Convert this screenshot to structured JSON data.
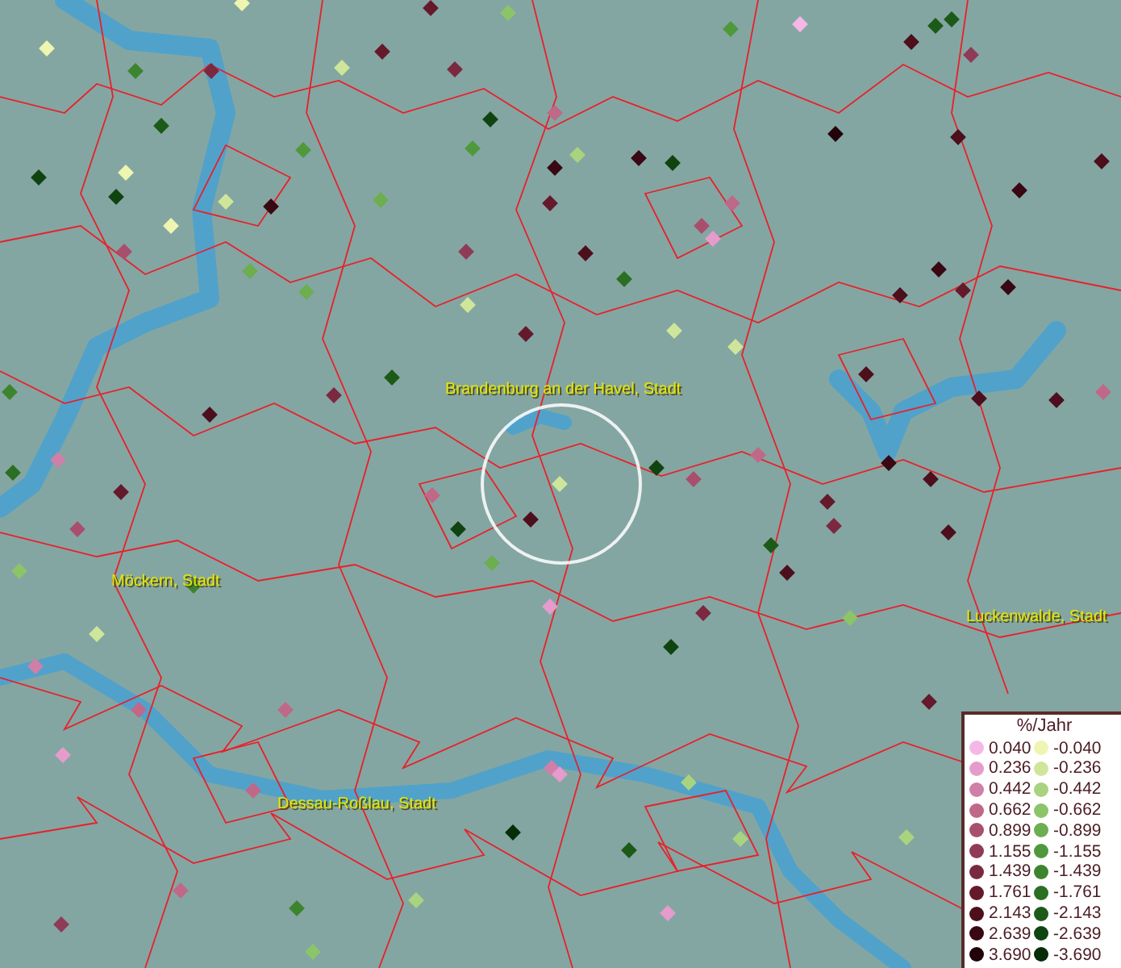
{
  "map": {
    "places": [
      {
        "name": "Brandenburg an der Havel, Stadt"
      },
      {
        "name": "Möckern, Stadt"
      },
      {
        "name": "Luckenwalde, Stadt"
      },
      {
        "name": "Dessau-Roßlau, Stadt"
      }
    ]
  },
  "legend": {
    "title": "%/Jahr",
    "entries": [
      {
        "label": "0.040",
        "color": "#f5b8e6"
      },
      {
        "label": "-0.040",
        "color": "#eef5b0"
      },
      {
        "label": "0.236",
        "color": "#e59ccc"
      },
      {
        "label": "-0.236",
        "color": "#cfe69a"
      },
      {
        "label": "0.442",
        "color": "#d07fa8"
      },
      {
        "label": "-0.442",
        "color": "#a9d37e"
      },
      {
        "label": "0.662",
        "color": "#c06888"
      },
      {
        "label": "-0.662",
        "color": "#8cc46a"
      },
      {
        "label": "0.899",
        "color": "#a84f6e"
      },
      {
        "label": "-0.899",
        "color": "#6cae50"
      },
      {
        "label": "1.155",
        "color": "#8f3b57"
      },
      {
        "label": "-1.155",
        "color": "#4f993c"
      },
      {
        "label": "1.439",
        "color": "#7a2940"
      },
      {
        "label": "-1.439",
        "color": "#3c852e"
      },
      {
        "label": "1.761",
        "color": "#651a2c"
      },
      {
        "label": "-1.761",
        "color": "#2b6f22"
      },
      {
        "label": "2.143",
        "color": "#4d0f1c"
      },
      {
        "label": "-2.143",
        "color": "#1c5a18"
      },
      {
        "label": "2.639",
        "color": "#380813"
      },
      {
        "label": "-2.639",
        "color": "#0f4410"
      },
      {
        "label": "3.690",
        "color": "#22030a"
      },
      {
        "label": "-3.690",
        "color": "#062d08"
      }
    ]
  }
}
